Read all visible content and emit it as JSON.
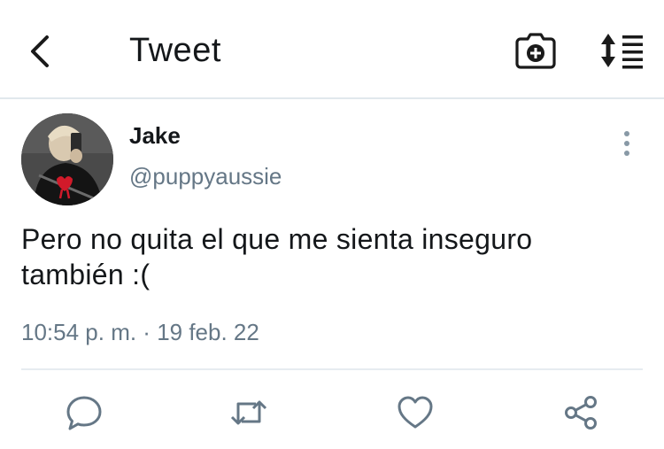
{
  "header": {
    "title": "Tweet",
    "back_icon": "chevron-left-icon",
    "camera_icon": "camera-plus-icon",
    "sort_icon": "sort-list-icon"
  },
  "tweet": {
    "author_name": "Jake",
    "author_handle": "@puppyaussie",
    "text": "Pero no quita el que me sienta inseguro también :(",
    "time": "10:54 p. m.",
    "separator": " · ",
    "date": "19 feb. 22"
  },
  "actions": {
    "reply_icon": "reply-icon",
    "retweet_icon": "retweet-icon",
    "like_icon": "heart-icon",
    "share_icon": "share-icon"
  },
  "colors": {
    "icon": "#1a1a1a",
    "secondary_text": "#657786",
    "action_icon": "#657786",
    "divider": "#e1e8ed"
  }
}
